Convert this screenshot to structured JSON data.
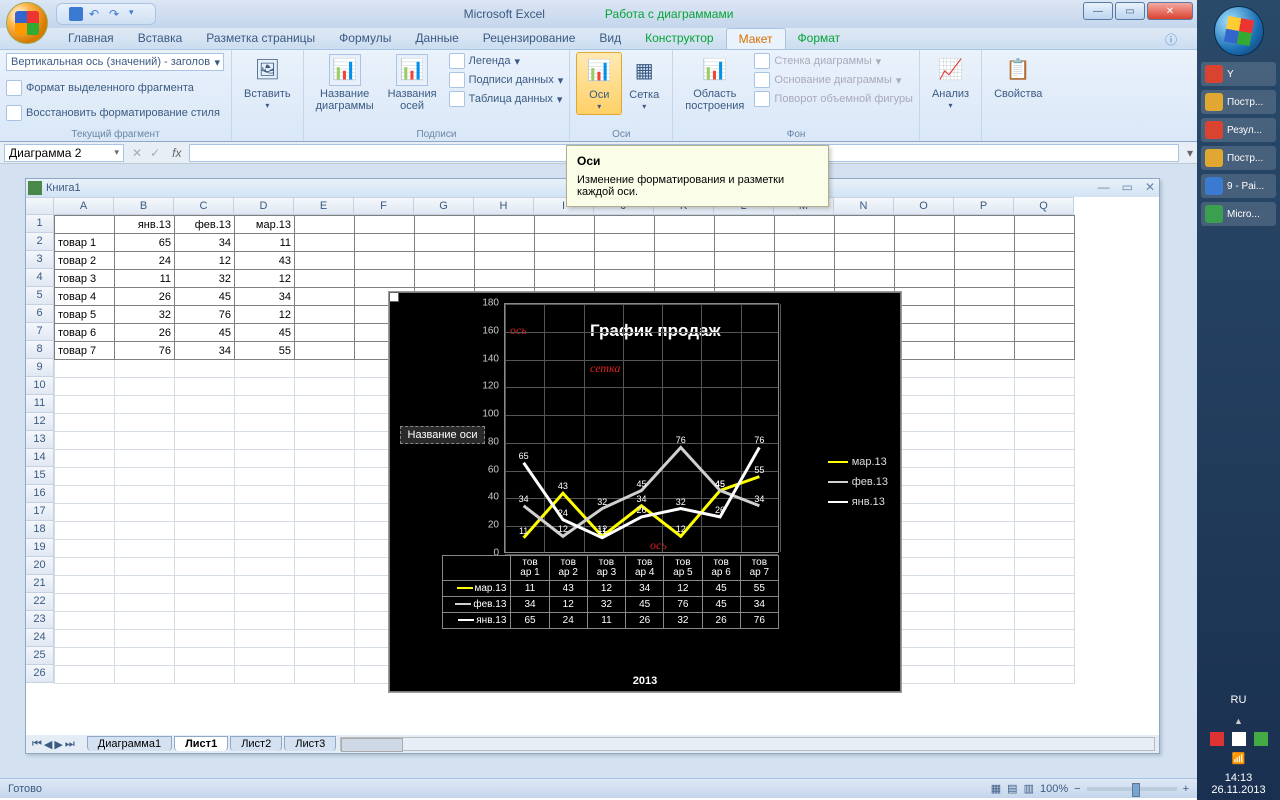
{
  "app_title": "Microsoft Excel",
  "context_tab_title": "Работа с диаграммами",
  "wb_name": "Книга1",
  "qat": [
    "save",
    "undo",
    "redo"
  ],
  "tabs": {
    "items": [
      "Главная",
      "Вставка",
      "Разметка страницы",
      "Формулы",
      "Данные",
      "Рецензирование",
      "Вид",
      "Конструктор",
      "Макет",
      "Формат"
    ],
    "active": "Макет",
    "context_start": 7
  },
  "ribbon": {
    "current_frag": {
      "combo": "Вертикальная ось (значений) - заголов",
      "format_sel": "Формат выделенного фрагмента",
      "reset": "Восстановить форматирование стиля",
      "label": "Текущий фрагмент"
    },
    "insert": {
      "btn": "Вставить",
      "label": ""
    },
    "labels": {
      "chart_title": "Название\nдиаграммы",
      "axis_titles": "Названия\nосей",
      "legend": "Легенда",
      "data_labels": "Подписи данных",
      "data_table": "Таблица данных",
      "group": "Подписи"
    },
    "axes": {
      "axes": "Оси",
      "grid": "Сетка",
      "group": "Оси"
    },
    "plot": {
      "area": "Область\nпостроения",
      "wall": "Стенка диаграммы",
      "floor": "Основание диаграммы",
      "rotation": "Поворот объемной фигуры",
      "group": "Фон"
    },
    "analysis": "Анализ",
    "props": "Свойства"
  },
  "tooltip": {
    "title": "Оси",
    "body": "Изменение форматирования и разметки каждой оси."
  },
  "name_box": "Диаграмма 2",
  "columns": [
    "A",
    "B",
    "C",
    "D",
    "E",
    "F",
    "G",
    "H",
    "I",
    "J",
    "K",
    "L",
    "M",
    "N",
    "O",
    "P",
    "Q"
  ],
  "row_count": 26,
  "table": {
    "headers": [
      "",
      "янв.13",
      "фев.13",
      "мар.13"
    ],
    "rows": [
      [
        "товар 1",
        "65",
        "34",
        "11"
      ],
      [
        "товар 2",
        "24",
        "12",
        "43"
      ],
      [
        "товар 3",
        "11",
        "32",
        "12"
      ],
      [
        "товар 4",
        "26",
        "45",
        "34"
      ],
      [
        "товар 5",
        "32",
        "76",
        "12"
      ],
      [
        "товар 6",
        "26",
        "45",
        "45"
      ],
      [
        "товар 7",
        "76",
        "34",
        "55"
      ]
    ]
  },
  "chart_data": {
    "type": "line",
    "title": "График продаж",
    "axis_title_box": "Название оси",
    "xaxis_title": "2013",
    "categories": [
      "тов\nар 1",
      "тов\nар 2",
      "тов\nар 3",
      "тов\nар 4",
      "тов\nар 5",
      "тов\nар 6",
      "тов\nар 7"
    ],
    "series": [
      {
        "name": "мар.13",
        "color": "#ffff00",
        "values": [
          11,
          43,
          12,
          34,
          12,
          45,
          55
        ],
        "labels": [
          "11",
          "43",
          "12",
          "34",
          "12",
          "45",
          "55"
        ]
      },
      {
        "name": "фев.13",
        "color": "#d0d0d0",
        "values": [
          34,
          12,
          32,
          45,
          76,
          45,
          34
        ],
        "labels": [
          "34",
          "12",
          "32",
          "45",
          "76",
          "45",
          "34"
        ]
      },
      {
        "name": "янв.13",
        "color": "#ffffff",
        "values": [
          65,
          24,
          11,
          26,
          32,
          26,
          76
        ],
        "labels": [
          "65",
          "24",
          "11",
          "26",
          "32",
          "26",
          "76"
        ]
      }
    ],
    "ylim": [
      0,
      180
    ],
    "yticks": [
      0,
      20,
      40,
      60,
      80,
      100,
      120,
      140,
      160,
      180
    ],
    "annotations": {
      "a1": "ось",
      "a2": "сетка",
      "a3": "ось"
    }
  },
  "sheet_tabs": [
    "Диаграмма1",
    "Лист1",
    "Лист2",
    "Лист3"
  ],
  "sheet_active": "Лист1",
  "status": "Готово",
  "zoom": "100%",
  "sidebar": {
    "items": [
      {
        "color": "#d94330",
        "label": "Y"
      },
      {
        "color": "#e0a830",
        "label": "Постр..."
      },
      {
        "color": "#d94330",
        "label": "Резул..."
      },
      {
        "color": "#e0a830",
        "label": "Постр..."
      },
      {
        "color": "#3a7ad0",
        "label": "9 - Pai..."
      },
      {
        "color": "#3aa050",
        "label": "Micro..."
      }
    ],
    "lang": "RU",
    "time": "14:13",
    "date": "26.11.2013"
  }
}
